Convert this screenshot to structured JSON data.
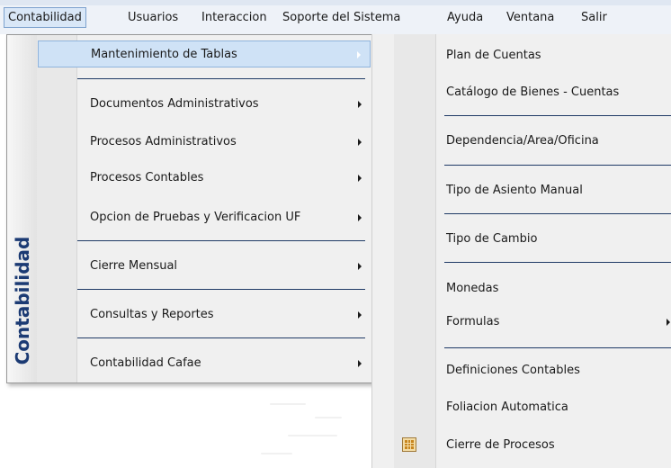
{
  "menubar": {
    "items": [
      "Contabilidad",
      "Usuarios",
      "Interaccion",
      "Soporte del Sistema",
      "Ayuda",
      "Ventana",
      "Salir"
    ]
  },
  "menu1": {
    "side_label": "Contabilidad",
    "items": [
      "Mantenimiento de Tablas",
      "Documentos Administrativos",
      "Procesos Administrativos",
      "Procesos Contables",
      "Opcion de Pruebas y Verificacion UF",
      "Cierre Mensual",
      "Consultas y Reportes",
      "Contabilidad Cafae"
    ]
  },
  "menu2": {
    "items": [
      "Plan de Cuentas",
      "Catálogo de Bienes - Cuentas",
      "Dependencia/Area/Oficina",
      "Tipo de Asiento Manual",
      "Tipo de Cambio",
      "Monedas",
      "Formulas",
      "Definiciones Contables",
      "Foliacion Automatica",
      "Cierre de Procesos"
    ]
  },
  "colors": {
    "highlight": "#cfe2f6",
    "separator": "#1f3a66",
    "side_label": "#1b3a73"
  }
}
